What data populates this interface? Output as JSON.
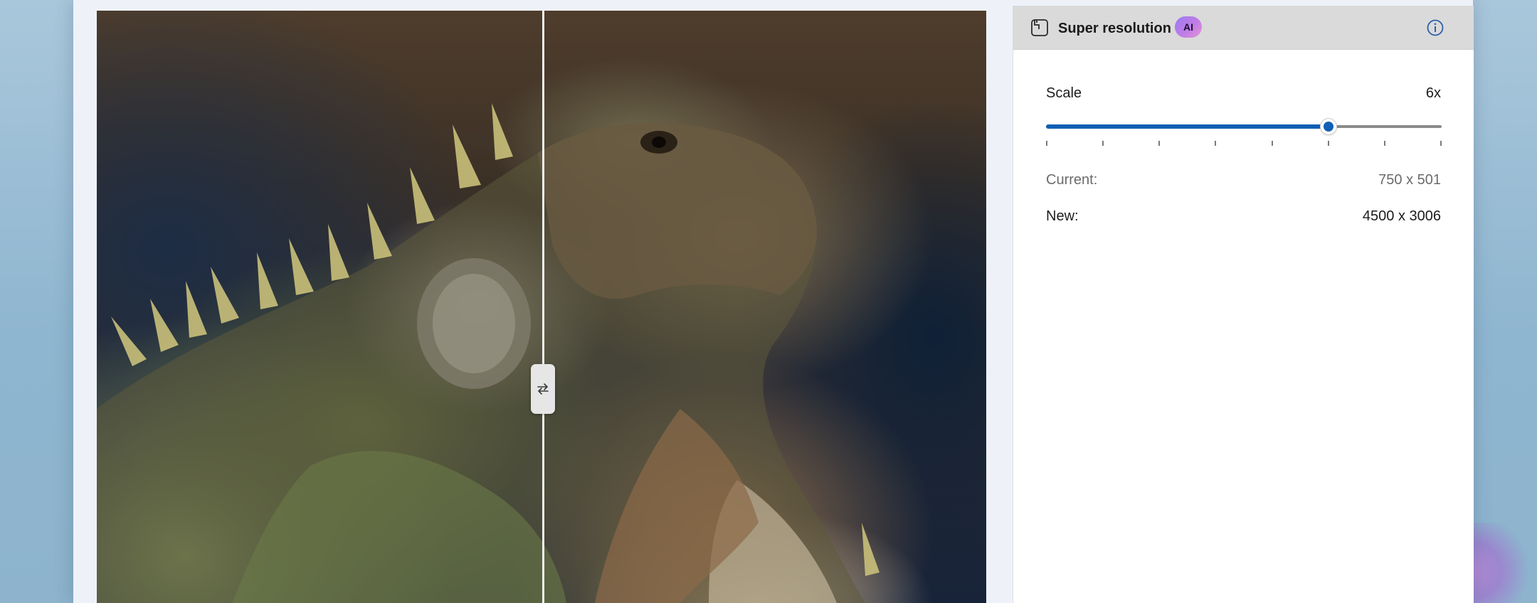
{
  "panel": {
    "title": "Super resolution",
    "badge": "AI",
    "info_icon": "info-icon",
    "tool_icon": "super-resolution-icon"
  },
  "scale": {
    "label": "Scale",
    "value": "6x",
    "slider": {
      "min": 1,
      "max": 8,
      "value": 6,
      "steps": 8
    }
  },
  "resolution": {
    "current_label": "Current:",
    "current_value": "750 x 501",
    "new_label": "New:",
    "new_value": "4500 x 3006"
  },
  "compare": {
    "handle_icon": "swap-arrows-icon"
  },
  "colors": {
    "accent": "#0f5fb4",
    "header_bg": "#dadada",
    "badge_gradient": [
      "#9b7bf2",
      "#e293d6"
    ]
  }
}
